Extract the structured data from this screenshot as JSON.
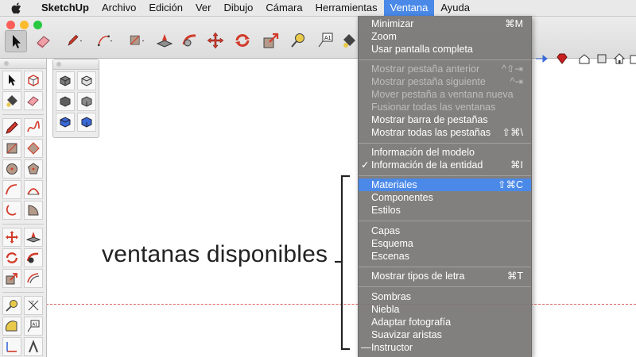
{
  "menubar": {
    "app": "SketchUp",
    "items": [
      "Archivo",
      "Edición",
      "Ver",
      "Dibujo",
      "Cámara",
      "Herramientas",
      "Ventana",
      "Ayuda"
    ]
  },
  "window_menu": {
    "items": [
      {
        "label": "Minimizar",
        "shortcut": "⌘M"
      },
      {
        "label": "Zoom",
        "shortcut": ""
      },
      {
        "label": "Usar pantalla completa",
        "shortcut": ""
      },
      {
        "label": "Mostrar pestaña anterior",
        "shortcut": "^⇧⇥"
      },
      {
        "label": "Mostrar pestaña siguiente",
        "shortcut": "^⇥"
      },
      {
        "label": "Mover pestaña a ventana nueva",
        "shortcut": ""
      },
      {
        "label": "Fusionar todas las ventanas",
        "shortcut": ""
      },
      {
        "label": "Mostrar barra de pestañas",
        "shortcut": ""
      },
      {
        "label": "Mostrar todas las pestañas",
        "shortcut": "⇧⌘\\"
      },
      {
        "label": "Información del modelo",
        "shortcut": ""
      },
      {
        "label": "Información de la entidad",
        "shortcut": "⌘I",
        "mark": "✓"
      },
      {
        "label": "Materiales",
        "shortcut": "⇧⌘C"
      },
      {
        "label": "Componentes",
        "shortcut": ""
      },
      {
        "label": "Estilos",
        "shortcut": ""
      },
      {
        "label": "Capas",
        "shortcut": ""
      },
      {
        "label": "Esquema",
        "shortcut": ""
      },
      {
        "label": "Escenas",
        "shortcut": ""
      },
      {
        "label": "Mostrar tipos de letra",
        "shortcut": "⌘T"
      },
      {
        "label": "Sombras",
        "shortcut": ""
      },
      {
        "label": "Niebla",
        "shortcut": ""
      },
      {
        "label": "Adaptar fotografía",
        "shortcut": ""
      },
      {
        "label": "Suavizar aristas",
        "shortcut": ""
      },
      {
        "label": "Instructor",
        "shortcut": "",
        "mark": "—"
      }
    ]
  },
  "annotation": {
    "text": "ventanas disponibles"
  },
  "colors": {
    "accent": "#4a89e8",
    "menu_bg": "#7a7876",
    "red_tool": "#d23a2a",
    "close": "#fc5f57",
    "minimize": "#fdbc2e",
    "zoom": "#28c840"
  }
}
